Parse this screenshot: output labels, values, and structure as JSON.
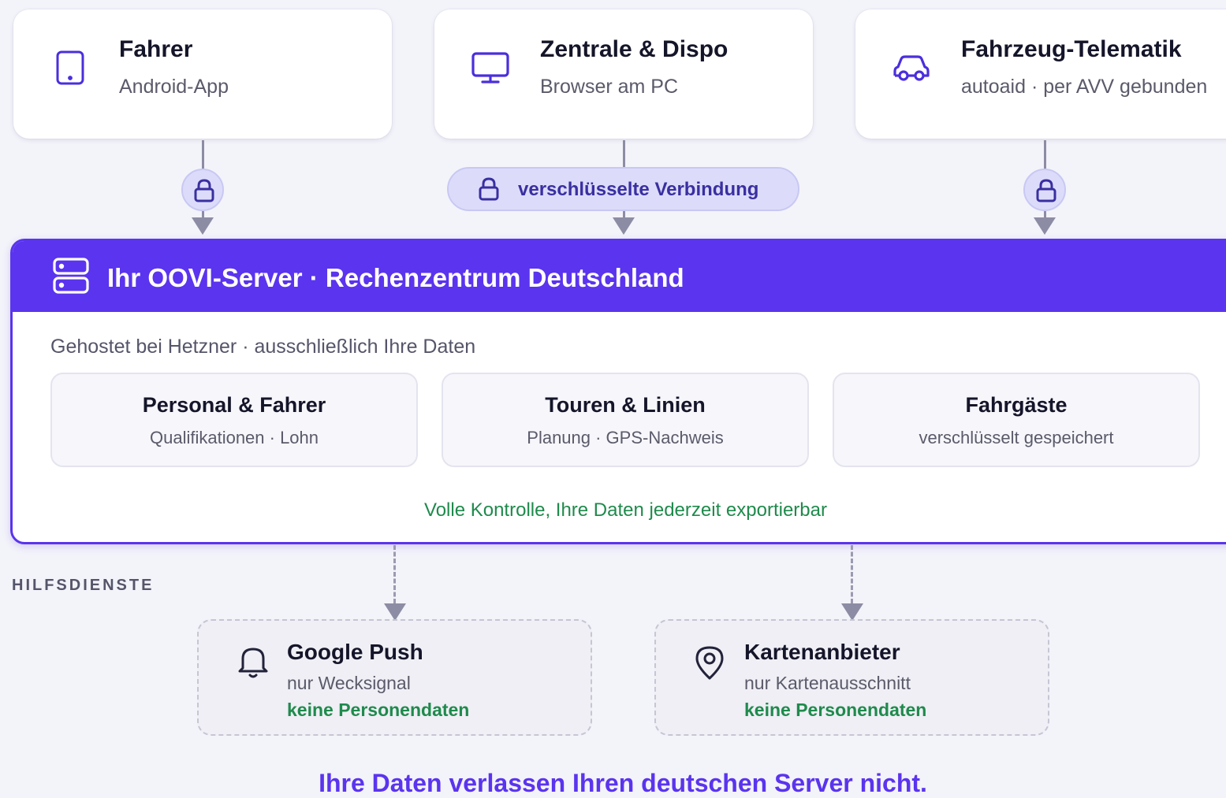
{
  "clients": [
    {
      "title": "Fahrer",
      "subtitle": "Android-App",
      "icon": "smartphone-icon"
    },
    {
      "title": "Zentrale & Dispo",
      "subtitle": "Browser am PC",
      "icon": "monitor-icon"
    },
    {
      "title": "Fahrzeug-Telematik",
      "subtitle": "autoaid · per AVV gebunden",
      "icon": "car-icon"
    }
  ],
  "connection_label": "verschlüsselte Verbindung",
  "server": {
    "title": "Ihr OOVI-Server · Rechenzentrum Deutschland",
    "hosted": "Gehostet bei Hetzner · ausschließlich Ihre Daten",
    "boxes": [
      {
        "title": "Personal & Fahrer",
        "subtitle": "Qualifikationen · Lohn"
      },
      {
        "title": "Touren & Linien",
        "subtitle": "Planung · GPS-Nachweis"
      },
      {
        "title": "Fahrgäste",
        "subtitle": "verschlüsselt gespeichert"
      }
    ],
    "control": "Volle Kontrolle, Ihre Daten jederzeit exportierbar"
  },
  "aux_section_label": "HILFSDIENSTE",
  "aux_services": [
    {
      "title": "Google Push",
      "subtitle": "nur Wecksignal",
      "note": "keine Personendaten",
      "icon": "bell-icon"
    },
    {
      "title": "Kartenanbieter",
      "subtitle": "nur Kartenausschnitt",
      "note": "keine Personendaten",
      "icon": "map-pin-icon"
    }
  ],
  "footer": "Ihre Daten verlassen Ihren deutschen Server nicht.",
  "colors": {
    "accent": "#5a34ee",
    "green": "#1f8a4c",
    "lock_bg": "#dcdcfa"
  }
}
